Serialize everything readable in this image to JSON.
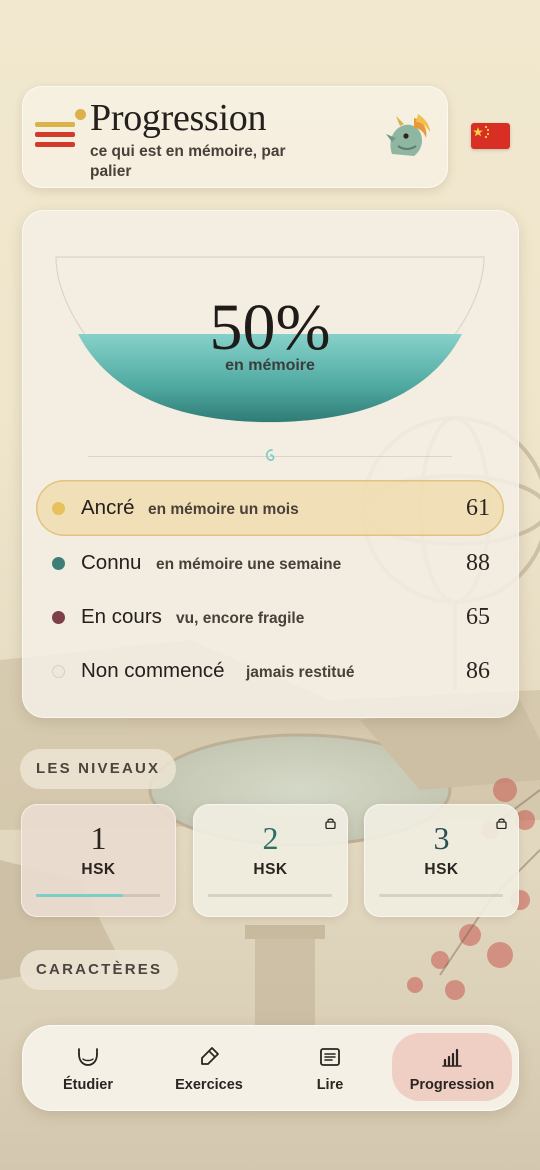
{
  "header": {
    "title": "Progression",
    "subtitle": "ce qui est en mémoire, par palier"
  },
  "summary": {
    "percent": "50%",
    "percent_label": "en mémoire",
    "fill_fraction": 0.5
  },
  "memory_levels": [
    {
      "name": "Ancré",
      "desc": "en mémoire un mois",
      "count": "61",
      "color": "#e8c15e"
    },
    {
      "name": "Connu",
      "desc": "en mémoire une semaine",
      "count": "88",
      "color": "#3d7f77"
    },
    {
      "name": "En cours",
      "desc": "vu, encore fragile",
      "count": "65",
      "color": "#7d4048"
    },
    {
      "name": "Non commencé",
      "desc": "jamais restitué",
      "count": "86",
      "color": "#efe6dc"
    }
  ],
  "levels_section": {
    "label": "LES NIVEAUX"
  },
  "levels": [
    {
      "number": "1",
      "name": "HSK",
      "progress": 0.7,
      "locked": false
    },
    {
      "number": "2",
      "name": "HSK",
      "progress": 0,
      "locked": true
    },
    {
      "number": "3",
      "name": "HSK",
      "progress": 0,
      "locked": true
    }
  ],
  "characters_section": {
    "label": "CARACTÈRES"
  },
  "nav": [
    {
      "label": "Étudier",
      "icon": "bowl-icon"
    },
    {
      "label": "Exercices",
      "icon": "brush-icon"
    },
    {
      "label": "Lire",
      "icon": "reader-icon"
    },
    {
      "label": "Progression",
      "icon": "bar-chart-icon"
    }
  ],
  "colors": {
    "accent_teal": "#6fc6bf",
    "accent_red": "#d23b2c",
    "accent_gold": "#dcb14c",
    "nav_active": "#efcfc3"
  }
}
